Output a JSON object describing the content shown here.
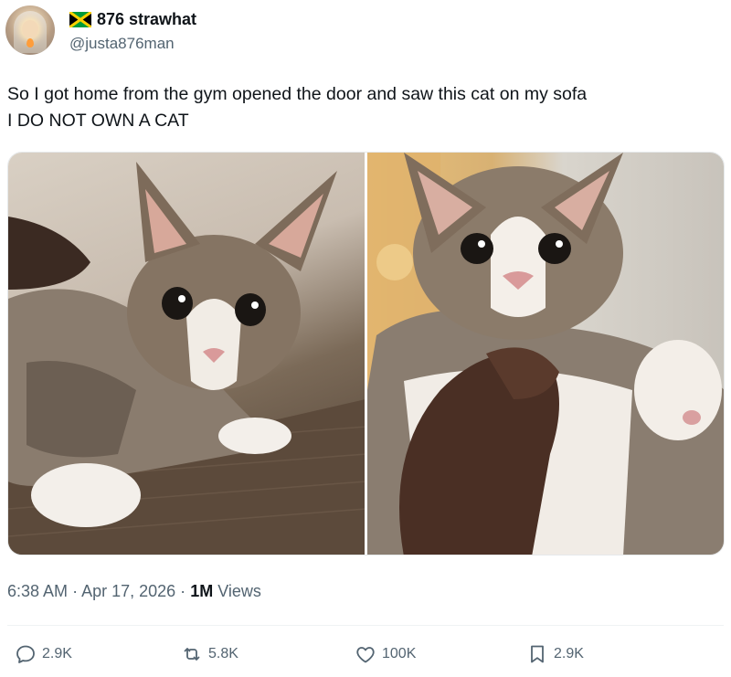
{
  "author": {
    "display_name": "876 strawhat",
    "handle": "@justa876man",
    "flag_icon": "jamaica-flag-icon",
    "avatar_icon": "hooded-figure-avatar"
  },
  "tweet": {
    "text_lines": [
      "So I got home from the gym opened the door and saw this cat on my sofa",
      "I DO NOT OWN A CAT"
    ]
  },
  "media": {
    "count": 2
  },
  "meta": {
    "time": "6:38 AM",
    "separator": "·",
    "date": "Apr 17, 2026",
    "views_count": "1M",
    "views_label": "Views"
  },
  "actions": {
    "reply": {
      "icon": "reply-icon",
      "count": "2.9K"
    },
    "repost": {
      "icon": "repost-icon",
      "count": "5.8K"
    },
    "like": {
      "icon": "heart-icon",
      "count": "100K"
    },
    "bookmark": {
      "icon": "bookmark-icon",
      "count": "2.9K"
    }
  },
  "colors": {
    "text_primary": "#0f1419",
    "text_secondary": "#536471",
    "divider": "#eff3f4",
    "flag_green": "#009b3a",
    "flag_yellow": "#fed100",
    "flag_black": "#000000"
  }
}
